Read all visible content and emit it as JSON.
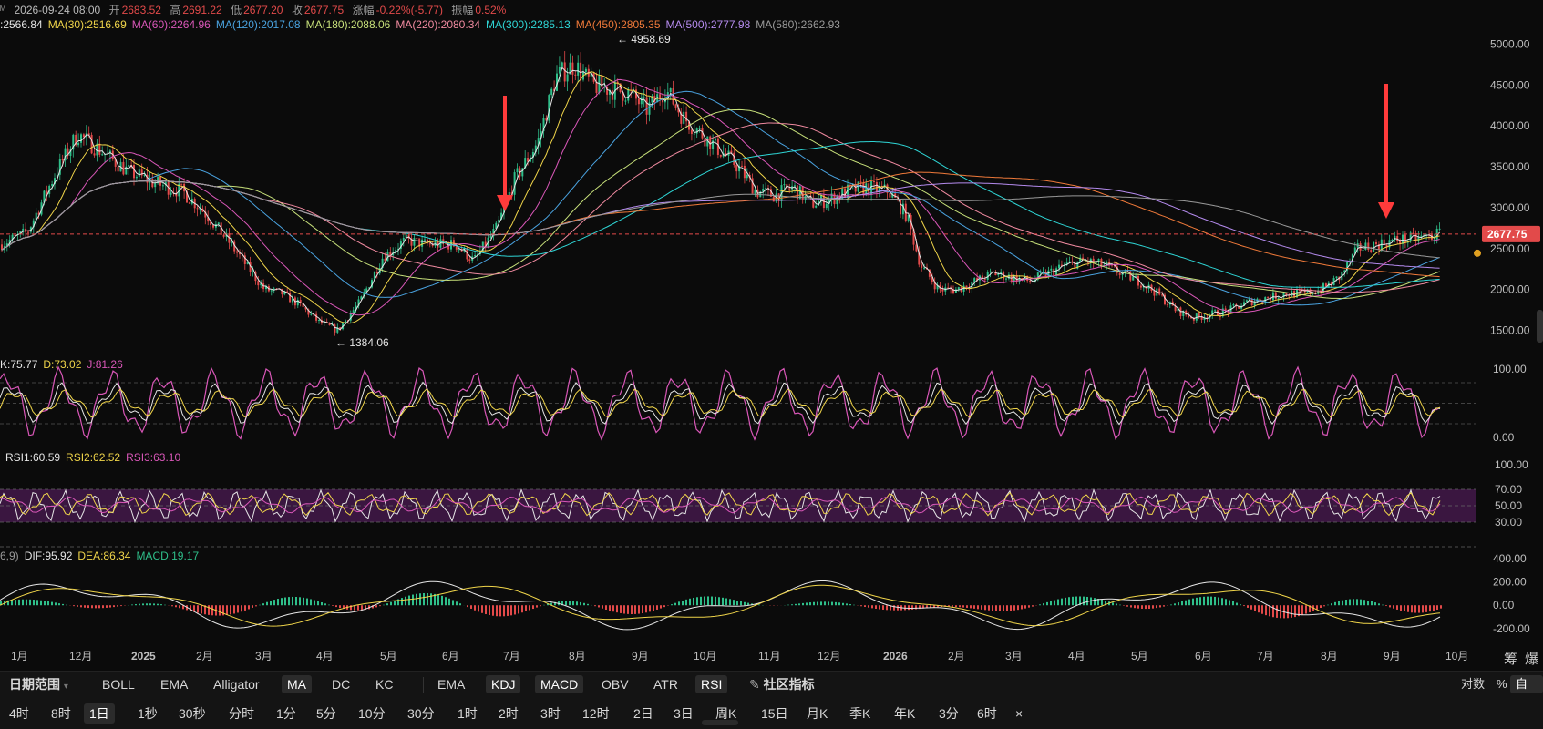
{
  "header": {
    "date": "2026-09-24 08:00",
    "open_label": "开",
    "open": "2683.52",
    "high_label": "高",
    "high": "2691.22",
    "low_label": "低",
    "low": "2677.20",
    "close_label": "收",
    "close": "2677.75",
    "change_label": "涨幅",
    "change": "-0.22%(-5.77)",
    "amp_label": "振幅",
    "amp": "0.52%"
  },
  "ma_legend": [
    {
      "label": ":2566.84",
      "color": "#e6e6e6"
    },
    {
      "label": "MA(30):2516.69",
      "color": "#f0d54a"
    },
    {
      "label": "MA(60):2264.96",
      "color": "#d957b8"
    },
    {
      "label": "MA(120):2017.08",
      "color": "#4aa3e0"
    },
    {
      "label": "MA(180):2088.06",
      "color": "#c7e07a"
    },
    {
      "label": "MA(220):2080.34",
      "color": "#f08aa0"
    },
    {
      "label": "MA(300):2285.13",
      "color": "#2fd6d6"
    },
    {
      "label": "MA(450):2805.35",
      "color": "#f07a3a"
    },
    {
      "label": "MA(500):2777.98",
      "color": "#b68cf0"
    },
    {
      "label": "MA(580):2662.93",
      "color": "#9a9a9a"
    }
  ],
  "kdj_legend": [
    {
      "label": "K:75.77",
      "color": "#e6e6e6"
    },
    {
      "label": "D:73.02",
      "color": "#f0d54a"
    },
    {
      "label": "J:81.26",
      "color": "#d957b8"
    }
  ],
  "rsi_legend": [
    {
      "label": "RSI1:60.59",
      "color": "#e6e6e6"
    },
    {
      "label": "RSI2:62.52",
      "color": "#f0d54a"
    },
    {
      "label": "RSI3:63.10",
      "color": "#d957b8"
    }
  ],
  "macd_legend": [
    {
      "label": "6,9)",
      "color": "#9a9a9a"
    },
    {
      "label": "DIF:95.92",
      "color": "#e6e6e6"
    },
    {
      "label": "DEA:86.34",
      "color": "#f0d54a"
    },
    {
      "label": "MACD:19.17",
      "color": "#2fbf8a"
    }
  ],
  "chart_data": {
    "type": "line",
    "price_axis": {
      "ticks": [
        "5000.00",
        "4500.00",
        "4000.00",
        "3500.00",
        "3000.00",
        "2500.00",
        "2000.00",
        "1500.00"
      ],
      "range": [
        1250,
        5150
      ]
    },
    "current_price": "2677.75",
    "high_marker": "← 4958.69",
    "low_marker": "← 1384.06",
    "kdj_axis": {
      "ticks": [
        "100.00",
        "0.00"
      ]
    },
    "rsi_axis": {
      "ticks": [
        "100.00",
        "70.00",
        "50.00",
        "30.00"
      ]
    },
    "macd_axis": {
      "ticks": [
        "400.00",
        "200.00",
        "0.00",
        "-200.00"
      ]
    },
    "x_labels": [
      "1月",
      "12月",
      "2025",
      "2月",
      "3月",
      "4月",
      "5月",
      "6月",
      "7月",
      "8月",
      "9月",
      "10月",
      "11月",
      "12月",
      "2026",
      "2月",
      "3月",
      "4月",
      "5月",
      "6月",
      "7月",
      "8月",
      "9月",
      "10月"
    ],
    "price_path": [
      [
        0,
        2550
      ],
      [
        30,
        2700
      ],
      [
        60,
        3400
      ],
      [
        85,
        3900
      ],
      [
        110,
        3700
      ],
      [
        140,
        3450
      ],
      [
        170,
        3300
      ],
      [
        200,
        3200
      ],
      [
        220,
        3000
      ],
      [
        250,
        2600
      ],
      [
        270,
        2300
      ],
      [
        290,
        2000
      ],
      [
        310,
        1950
      ],
      [
        330,
        1800
      ],
      [
        350,
        1600
      ],
      [
        370,
        1500
      ],
      [
        395,
        1850
      ],
      [
        420,
        2400
      ],
      [
        445,
        2600
      ],
      [
        470,
        2550
      ],
      [
        500,
        2550
      ],
      [
        520,
        2350
      ],
      [
        545,
        2750
      ],
      [
        565,
        3350
      ],
      [
        590,
        3800
      ],
      [
        610,
        4600
      ],
      [
        630,
        4750
      ],
      [
        650,
        4500
      ],
      [
        670,
        4450
      ],
      [
        690,
        4400
      ],
      [
        710,
        4200
      ],
      [
        730,
        4450
      ],
      [
        750,
        4100
      ],
      [
        770,
        3900
      ],
      [
        790,
        3700
      ],
      [
        810,
        3500
      ],
      [
        830,
        3200
      ],
      [
        850,
        3150
      ],
      [
        870,
        3250
      ],
      [
        890,
        3050
      ],
      [
        910,
        3100
      ],
      [
        930,
        3200
      ],
      [
        950,
        3250
      ],
      [
        975,
        3200
      ],
      [
        995,
        2900
      ],
      [
        1010,
        2300
      ],
      [
        1030,
        2000
      ],
      [
        1050,
        2000
      ],
      [
        1070,
        2100
      ],
      [
        1090,
        2200
      ],
      [
        1110,
        2150
      ],
      [
        1130,
        2100
      ],
      [
        1150,
        2200
      ],
      [
        1170,
        2300
      ],
      [
        1190,
        2350
      ],
      [
        1210,
        2300
      ],
      [
        1230,
        2200
      ],
      [
        1250,
        2100
      ],
      [
        1270,
        1950
      ],
      [
        1290,
        1750
      ],
      [
        1310,
        1650
      ],
      [
        1330,
        1700
      ],
      [
        1350,
        1750
      ],
      [
        1370,
        1850
      ],
      [
        1390,
        1900
      ],
      [
        1410,
        1950
      ],
      [
        1430,
        1950
      ],
      [
        1450,
        2000
      ],
      [
        1470,
        2150
      ],
      [
        1490,
        2500
      ],
      [
        1510,
        2550
      ],
      [
        1530,
        2600
      ],
      [
        1550,
        2620
      ],
      [
        1570,
        2650
      ],
      [
        1580,
        2690
      ]
    ]
  },
  "indicator_bar": {
    "date_range": "日期范围",
    "items": [
      "BOLL",
      "EMA",
      "Alligator",
      "MA",
      "DC",
      "KC"
    ],
    "items_right": [
      "EMA",
      "KDJ",
      "MACD",
      "OBV",
      "ATR",
      "RSI"
    ],
    "community": "社区指标",
    "right": [
      "对数",
      "%",
      "自动"
    ],
    "top_right": [
      "筹",
      "爆"
    ]
  },
  "timeframes": [
    "4时",
    "8时",
    "1日",
    "1秒",
    "30秒",
    "分时",
    "1分",
    "5分",
    "10分",
    "30分",
    "1时",
    "2时",
    "3时",
    "12时",
    "2日",
    "3日",
    "周K",
    "15日",
    "月K",
    "季K",
    "年K",
    "3分",
    "6时"
  ],
  "active_timeframe": "1日",
  "close_icon": "×",
  "colors": {
    "up": "#2fbf8a",
    "down": "#e24a4a",
    "arrow": "#ff3b3b",
    "current_price_bg": "#e24a4a"
  }
}
